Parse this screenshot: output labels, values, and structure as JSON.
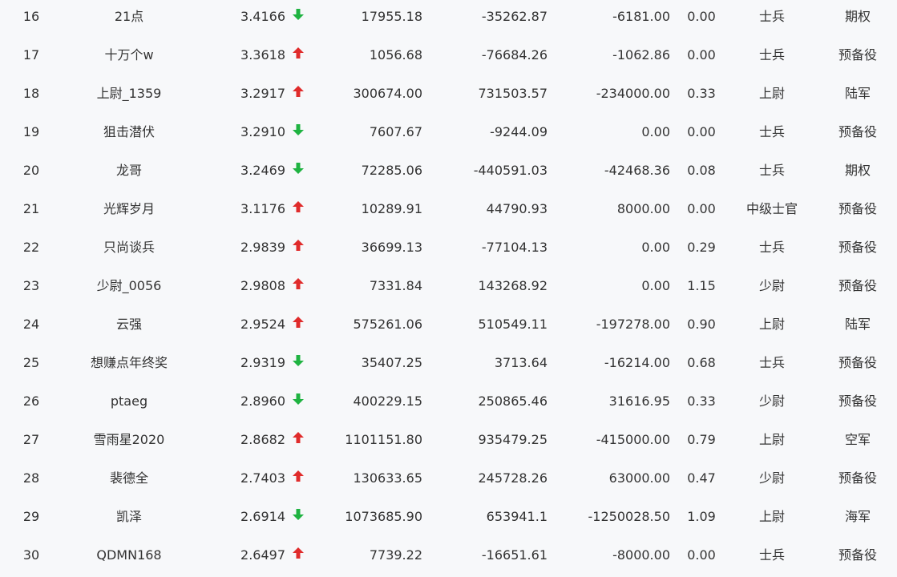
{
  "colors": {
    "background": "#f7f8fa",
    "text": "#333333",
    "up": "#e02b2b",
    "down": "#1fb341"
  },
  "rows": [
    {
      "rank": "16",
      "name": "21点",
      "score": "3.4166",
      "trend": "down",
      "v1": "17955.18",
      "v2": "-35262.87",
      "v3": "-6181.00",
      "ratio": "0.00",
      "level": "士兵",
      "type": "期权"
    },
    {
      "rank": "17",
      "name": "十万个w",
      "score": "3.3618",
      "trend": "up",
      "v1": "1056.68",
      "v2": "-76684.26",
      "v3": "-1062.86",
      "ratio": "0.00",
      "level": "士兵",
      "type": "预备役"
    },
    {
      "rank": "18",
      "name": "上尉_1359",
      "score": "3.2917",
      "trend": "up",
      "v1": "300674.00",
      "v2": "731503.57",
      "v3": "-234000.00",
      "ratio": "0.33",
      "level": "上尉",
      "type": "陆军"
    },
    {
      "rank": "19",
      "name": "狙击潜伏",
      "score": "3.2910",
      "trend": "down",
      "v1": "7607.67",
      "v2": "-9244.09",
      "v3": "0.00",
      "ratio": "0.00",
      "level": "士兵",
      "type": "预备役"
    },
    {
      "rank": "20",
      "name": "龙哥",
      "score": "3.2469",
      "trend": "down",
      "v1": "72285.06",
      "v2": "-440591.03",
      "v3": "-42468.36",
      "ratio": "0.08",
      "level": "士兵",
      "type": "期权"
    },
    {
      "rank": "21",
      "name": "光辉岁月",
      "score": "3.1176",
      "trend": "up",
      "v1": "10289.91",
      "v2": "44790.93",
      "v3": "8000.00",
      "ratio": "0.00",
      "level": "中级士官",
      "type": "预备役"
    },
    {
      "rank": "22",
      "name": "只尚谈兵",
      "score": "2.9839",
      "trend": "up",
      "v1": "36699.13",
      "v2": "-77104.13",
      "v3": "0.00",
      "ratio": "0.29",
      "level": "士兵",
      "type": "预备役"
    },
    {
      "rank": "23",
      "name": "少尉_0056",
      "score": "2.9808",
      "trend": "up",
      "v1": "7331.84",
      "v2": "143268.92",
      "v3": "0.00",
      "ratio": "1.15",
      "level": "少尉",
      "type": "预备役"
    },
    {
      "rank": "24",
      "name": "云强",
      "score": "2.9524",
      "trend": "up",
      "v1": "575261.06",
      "v2": "510549.11",
      "v3": "-197278.00",
      "ratio": "0.90",
      "level": "上尉",
      "type": "陆军"
    },
    {
      "rank": "25",
      "name": "想赚点年终奖",
      "score": "2.9319",
      "trend": "down",
      "v1": "35407.25",
      "v2": "3713.64",
      "v3": "-16214.00",
      "ratio": "0.68",
      "level": "士兵",
      "type": "预备役"
    },
    {
      "rank": "26",
      "name": "ptaeg",
      "score": "2.8960",
      "trend": "down",
      "v1": "400229.15",
      "v2": "250865.46",
      "v3": "31616.95",
      "ratio": "0.33",
      "level": "少尉",
      "type": "预备役"
    },
    {
      "rank": "27",
      "name": "雪雨星2020",
      "score": "2.8682",
      "trend": "up",
      "v1": "1101151.80",
      "v2": "935479.25",
      "v3": "-415000.00",
      "ratio": "0.79",
      "level": "上尉",
      "type": "空军"
    },
    {
      "rank": "28",
      "name": "裴德全",
      "score": "2.7403",
      "trend": "up",
      "v1": "130633.65",
      "v2": "245728.26",
      "v3": "63000.00",
      "ratio": "0.47",
      "level": "少尉",
      "type": "预备役"
    },
    {
      "rank": "29",
      "name": "凯泽",
      "score": "2.6914",
      "trend": "down",
      "v1": "1073685.90",
      "v2": "653941.1",
      "v3": "-1250028.50",
      "ratio": "1.09",
      "level": "上尉",
      "type": "海军"
    },
    {
      "rank": "30",
      "name": "QDMN168",
      "score": "2.6497",
      "trend": "up",
      "v1": "7739.22",
      "v2": "-16651.61",
      "v3": "-8000.00",
      "ratio": "0.00",
      "level": "士兵",
      "type": "预备役"
    }
  ]
}
